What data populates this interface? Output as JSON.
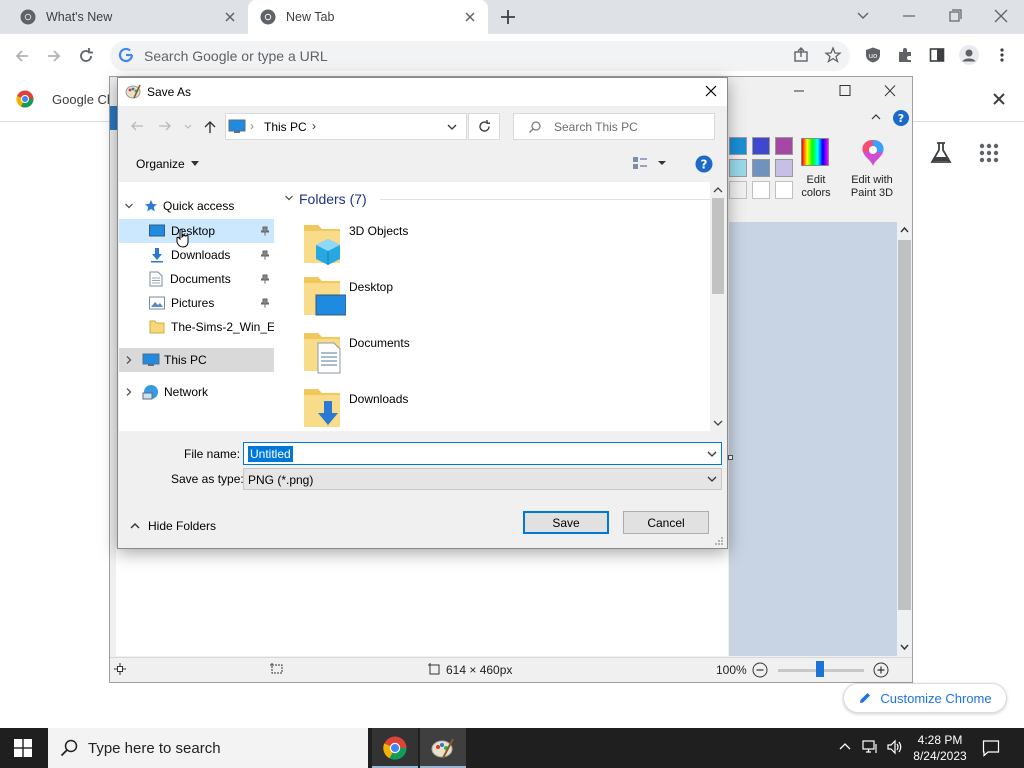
{
  "browser": {
    "tabs": [
      {
        "title": "What's New"
      },
      {
        "title": "New Tab"
      }
    ],
    "omnibox_placeholder": "Search Google or type a URL",
    "bookmark_label": "Google Ch",
    "customize_label": "Customize Chrome"
  },
  "paint": {
    "ribbon": {
      "edit_colors": [
        "Edit",
        "colors"
      ],
      "edit_paint3d": [
        "Edit with",
        "Paint 3D"
      ]
    },
    "status": {
      "size": "614 × 460px",
      "zoom": "100%"
    },
    "palette": [
      "#1c8ed6",
      "#3f48cc",
      "#a349a4",
      "#99d9ea",
      "#7092be",
      "#c8bfe7",
      "#f0f0f0",
      "#ffffff",
      "#ffffff"
    ]
  },
  "dialog": {
    "title": "Save As",
    "address": "This PC",
    "search_placeholder": "Search This PC",
    "organize": "Organize",
    "nav": {
      "quick_access": "Quick access",
      "items": [
        {
          "label": "Desktop"
        },
        {
          "label": "Downloads"
        },
        {
          "label": "Documents"
        },
        {
          "label": "Pictures"
        },
        {
          "label": "The-Sims-2_Win_EN"
        }
      ],
      "this_pc": "This PC",
      "network": "Network"
    },
    "group_header": "Folders (7)",
    "folders": [
      {
        "name": "3D Objects"
      },
      {
        "name": "Desktop"
      },
      {
        "name": "Documents"
      },
      {
        "name": "Downloads"
      }
    ],
    "file_name_label": "File name:",
    "file_name_value": "Untitled",
    "save_type_label": "Save as type:",
    "save_type_value": "PNG (*.png)",
    "hide_folders": "Hide Folders",
    "save_button": "Save",
    "cancel_button": "Cancel"
  },
  "taskbar": {
    "search_placeholder": "Type here to search",
    "time": "4:28 PM",
    "date": "8/24/2023"
  }
}
